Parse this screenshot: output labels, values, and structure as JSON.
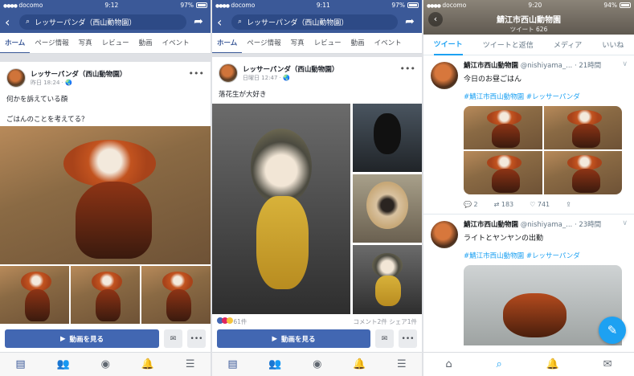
{
  "status": [
    {
      "carrier": "docomo",
      "time": "9:12",
      "battery": "97%"
    },
    {
      "carrier": "docomo",
      "time": "9:11",
      "battery": "97%"
    },
    {
      "carrier": "docomo",
      "time": "9:20",
      "battery": "94%"
    }
  ],
  "fb": {
    "search": "レッサーパンダ（西山動物園）",
    "tabs": [
      "ホーム",
      "ページ情報",
      "写真",
      "レビュー",
      "動画",
      "イベント"
    ],
    "page_name": "レッサーパンダ（西山動物園）",
    "post1": {
      "time": "昨日 18:24 · 🌏",
      "line1": "何かを訴えている顔",
      "line2": "ごはんのことを考えてる？"
    },
    "post2": {
      "time": "日曜日 12:47 · 🌏",
      "line1": "落花生が大好き",
      "reactions": "61件",
      "comments": "コメント2件",
      "shares": "シェア1件"
    },
    "watch_video": "動画を見る"
  },
  "tw": {
    "title": "鯖江市西山動物園",
    "subtitle": "ツイート 626",
    "tabs": [
      "ツイート",
      "ツイートと返信",
      "メディア",
      "いいね"
    ],
    "tweet1": {
      "name": "鯖江市西山動物園",
      "handle": "@nishiyama_...",
      "time": "· 21時間",
      "text": "今日のお昼ごはん",
      "tags": "#鯖江市西山動物園 #レッサーパンダ",
      "replies": "2",
      "retweets": "183",
      "likes": "741"
    },
    "tweet2": {
      "name": "鯖江市西山動物園",
      "handle": "@nishiyama_...",
      "time": "· 23時間",
      "text": "ライトとヤンヤンの出勤",
      "tags": "#鯖江市西山動物園 #レッサーパンダ"
    }
  },
  "colors": {
    "fb": "#3b5998",
    "tw": "#1da1f2"
  }
}
